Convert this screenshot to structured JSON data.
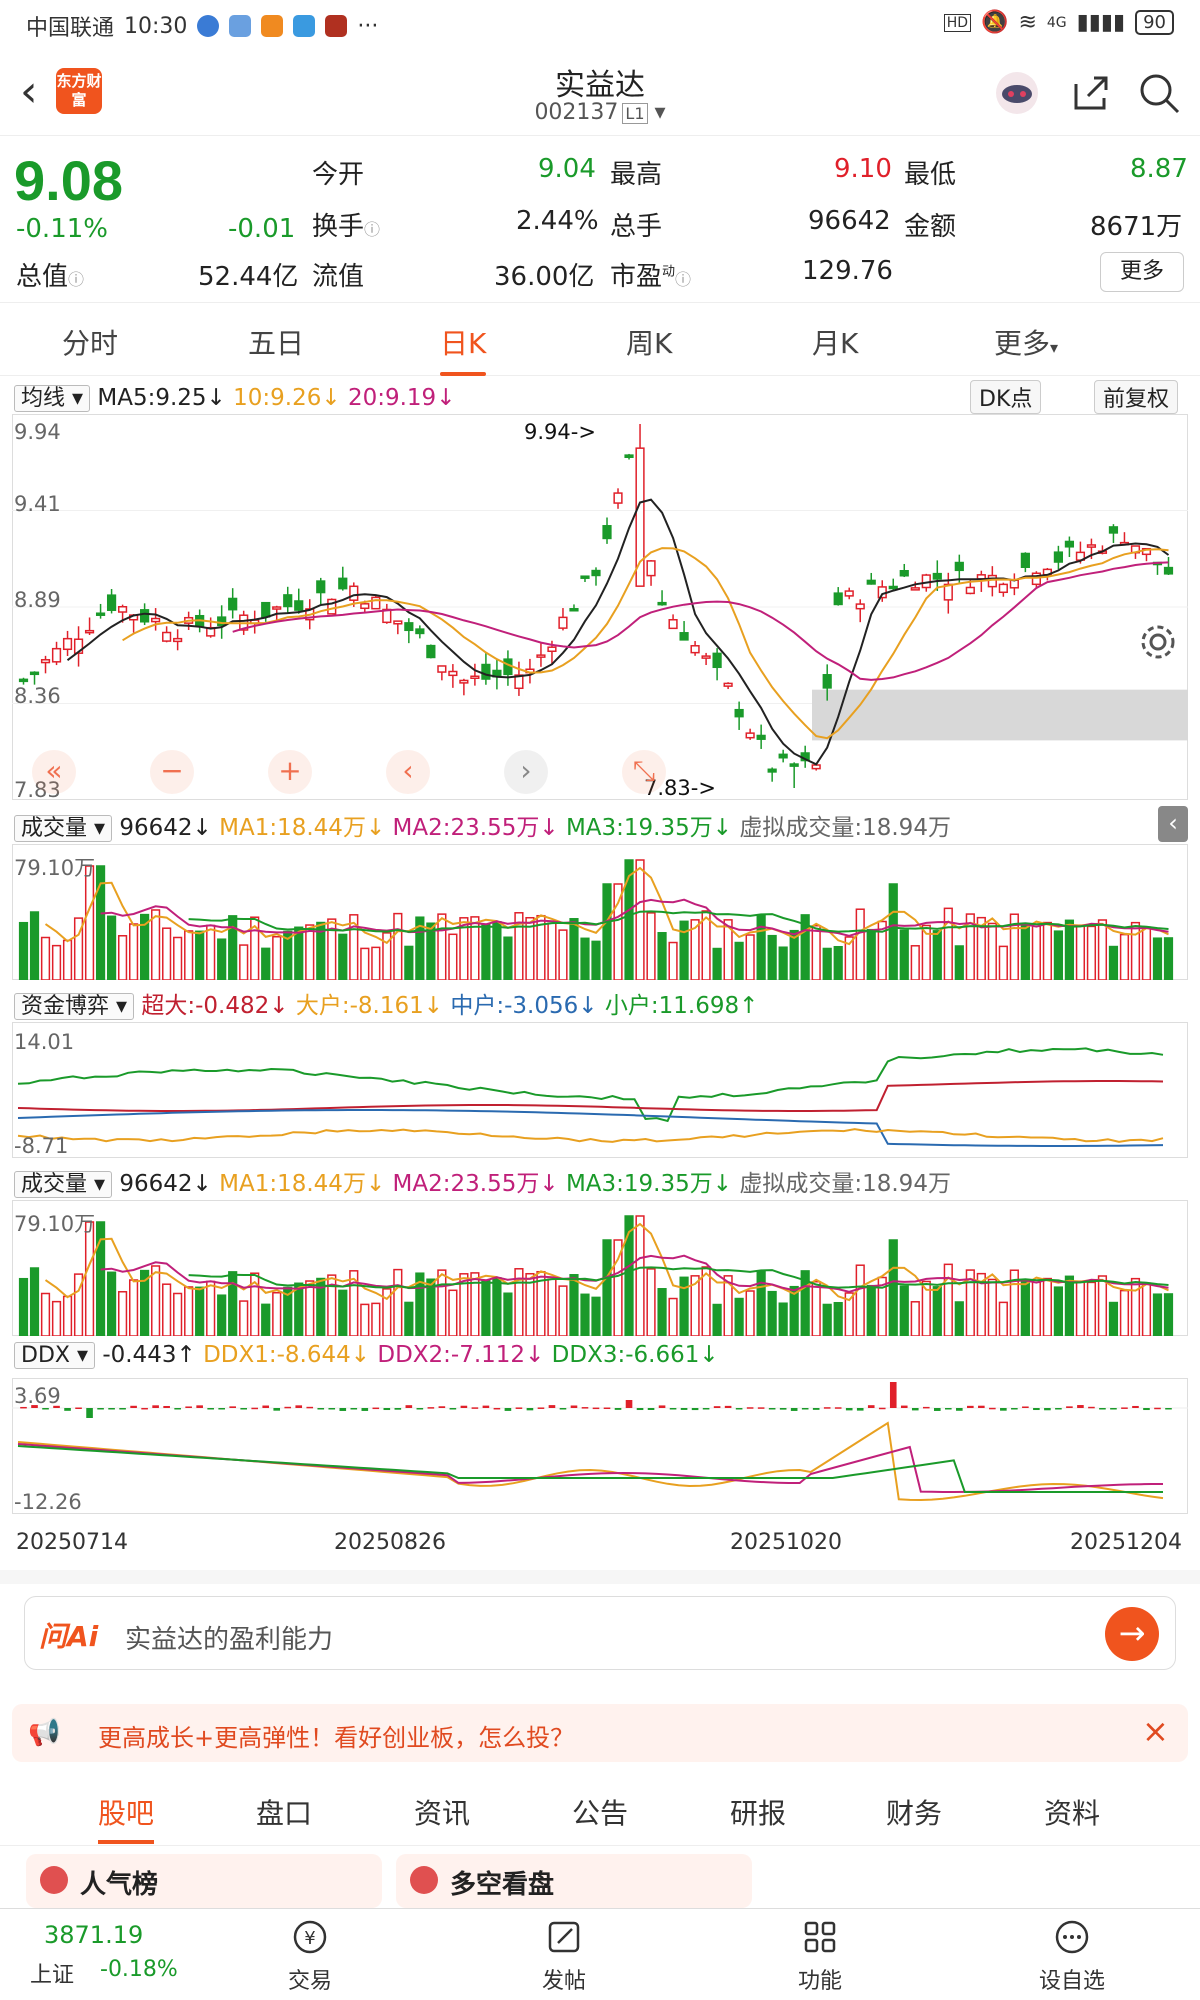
{
  "status_bar": {
    "carrier": "中国联通",
    "time": "10:30",
    "network": "4G",
    "battery": "90"
  },
  "header": {
    "title": "实益达",
    "code": "002137",
    "code_tag": "L1",
    "logo_text": "东方财富"
  },
  "quote": {
    "price": "9.08",
    "change_pct": "-0.11%",
    "change": "-0.01",
    "open_label": "今开",
    "open": "9.04",
    "high_label": "最高",
    "high": "9.10",
    "low_label": "最低",
    "low": "8.87",
    "turnover_label": "换手",
    "turnover": "2.44%",
    "volume_label": "总手",
    "volume": "96642",
    "amount_label": "金额",
    "amount": "8671万",
    "mktcap_label": "总值",
    "mktcap": "52.44亿",
    "float_label": "流值",
    "float": "36.00亿",
    "pe_label": "市盈",
    "pe_sup": "动",
    "pe": "129.76",
    "more_label": "更多"
  },
  "tabs": [
    {
      "label": "分时"
    },
    {
      "label": "五日"
    },
    {
      "label": "日K"
    },
    {
      "label": "周K"
    },
    {
      "label": "月K"
    },
    {
      "label": "更多"
    }
  ],
  "kline": {
    "indicator": "均线",
    "ma5": "MA5:9.25",
    "ma10": "10:9.26",
    "ma20": "20:9.19",
    "dk": "DK点",
    "adjust": "前复权",
    "y_top": "9.94",
    "y_2": "9.41",
    "y_3": "8.89",
    "y_4": "8.36",
    "y_bot": "7.83",
    "max_marker": "9.94->",
    "min_marker": "7.83->"
  },
  "vol1": {
    "indicator": "成交量",
    "value": "96642",
    "ma1": "MA1:18.44万",
    "ma2": "MA2:23.55万",
    "ma3": "MA3:19.35万",
    "virtual": "虚拟成交量:18.94万",
    "ymax": "79.10万"
  },
  "fund": {
    "indicator": "资金博弈",
    "super": "超大:-0.482",
    "big": "大户:-8.161",
    "mid": "中户:-3.056",
    "small": "小户:11.698",
    "ymax": "14.01",
    "ymin": "-8.71"
  },
  "vol2": {
    "indicator": "成交量",
    "value": "96642",
    "ma1": "MA1:18.44万",
    "ma2": "MA2:23.55万",
    "ma3": "MA3:19.35万",
    "virtual": "虚拟成交量:18.94万",
    "ymax": "79.10万"
  },
  "ddx": {
    "indicator": "DDX",
    "value": "-0.443",
    "ddx1": "DDX1:-8.644",
    "ddx2": "DDX2:-7.112",
    "ddx3": "DDX3:-6.661",
    "ymax": "3.69",
    "ymin": "-12.26"
  },
  "dates": [
    "20250714",
    "20250826",
    "20251020",
    "20251204"
  ],
  "ai": {
    "brand": "问Ai",
    "placeholder": "实益达的盈利能力"
  },
  "banner": {
    "text": "更高成长+更高弹性！看好创业板，怎么投？"
  },
  "subtabs": [
    {
      "label": "股吧"
    },
    {
      "label": "盘口"
    },
    {
      "label": "资讯"
    },
    {
      "label": "公告"
    },
    {
      "label": "研报"
    },
    {
      "label": "财务"
    },
    {
      "label": "资料"
    }
  ],
  "cards": {
    "popular": "人气榜",
    "longshort": "多空看盘"
  },
  "bottom": {
    "index_value": "3871.19",
    "index_name": "上证",
    "index_change": "-0.18%",
    "trade": "交易",
    "post": "发帖",
    "func": "功能",
    "watch": "设自选"
  },
  "colors": {
    "up": "#e0202a",
    "down": "#1a9a2a",
    "accent": "#f0541e",
    "ma5": "#222222",
    "ma10": "#e8a020",
    "ma20": "#c0207a"
  }
}
